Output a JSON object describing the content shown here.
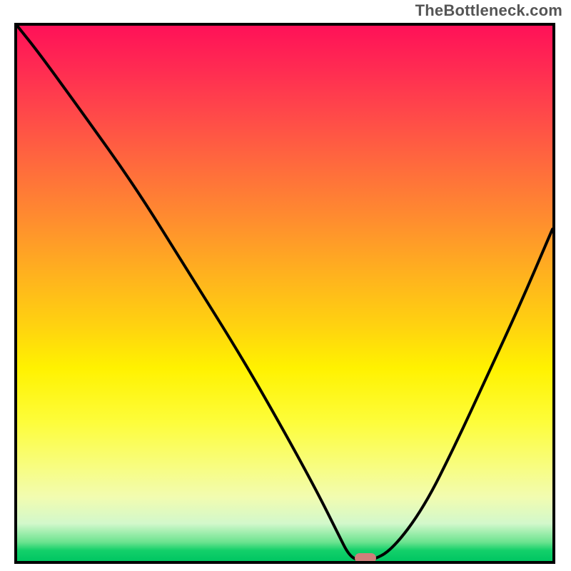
{
  "watermark": "TheBottleneck.com",
  "chart_data": {
    "type": "line",
    "title": "",
    "xlabel": "",
    "ylabel": "",
    "xlim": [
      0,
      100
    ],
    "ylim": [
      0,
      100
    ],
    "grid": false,
    "legend": false,
    "series": [
      {
        "name": "bottleneck-curve",
        "x": [
          0,
          4,
          12,
          22,
          32,
          42,
          50,
          56,
          60,
          62,
          64,
          66,
          70,
          76,
          82,
          88,
          94,
          100
        ],
        "values": [
          100,
          95,
          84,
          70,
          54,
          38,
          24,
          13,
          5,
          1,
          0,
          0,
          2,
          10,
          22,
          35,
          48,
          62
        ],
        "_comment": "y axis inverted in render: 0 at bottom, 100 at top; estimated off pixel reading"
      }
    ],
    "marker": {
      "name": "sweet-spot",
      "x": 65,
      "y": 0
    },
    "background": "rainbow-vertical",
    "colors": {
      "top": "#ff1158",
      "mid": "#fff200",
      "bottom": "#00c662",
      "curve": "#000000",
      "marker": "#d07f7b"
    }
  }
}
